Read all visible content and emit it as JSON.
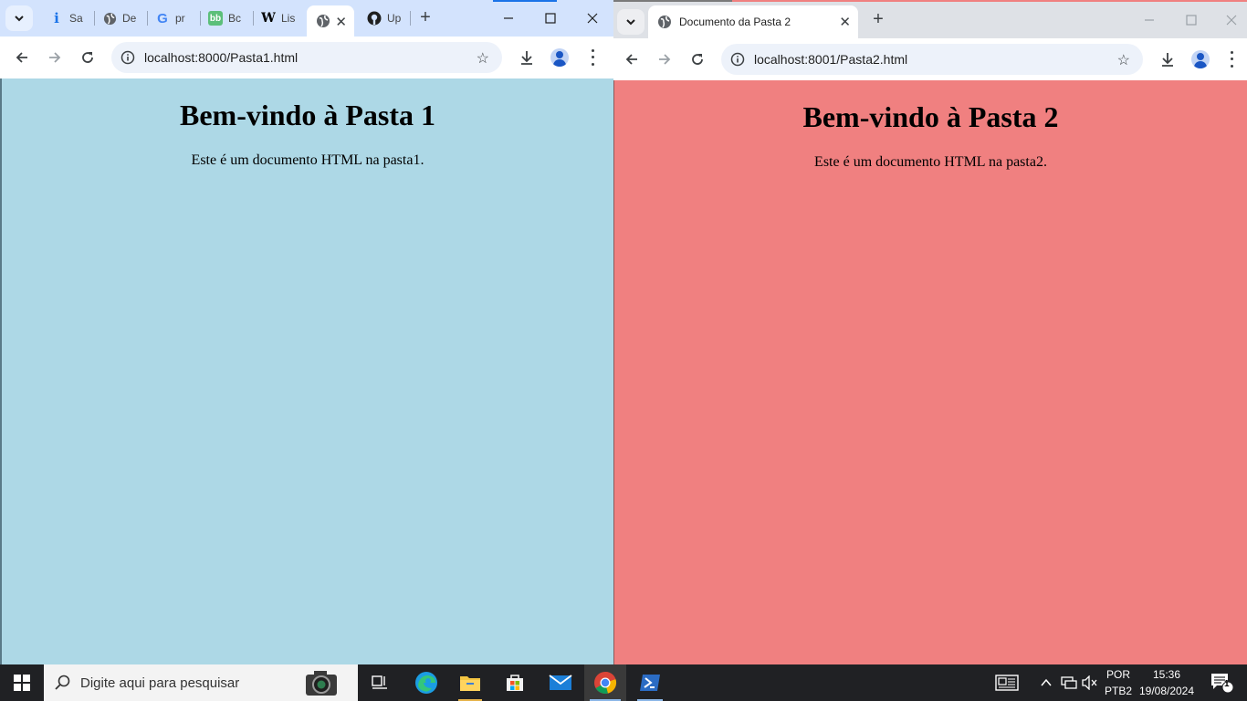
{
  "left_window": {
    "tabs": [
      {
        "label": "Sa"
      },
      {
        "label": "De"
      },
      {
        "label": "pr"
      },
      {
        "label": "Bc"
      },
      {
        "label": "Lis"
      },
      {
        "label": ""
      },
      {
        "label": "Up"
      }
    ],
    "url": "localhost:8000/Pasta1.html",
    "page": {
      "heading": "Bem-vindo à Pasta 1",
      "text": "Este é um documento HTML na pasta1."
    },
    "background": "#add8e6"
  },
  "right_window": {
    "active_tab": "Documento da Pasta 2",
    "url": "localhost:8001/Pasta2.html",
    "page": {
      "heading": "Bem-vindo à Pasta 2",
      "text": "Este é um documento HTML na pasta2."
    },
    "background": "#f08080"
  },
  "taskbar": {
    "search_placeholder": "Digite aqui para pesquisar",
    "language": "POR",
    "layout": "PTB2",
    "time": "15:36",
    "date": "19/08/2024",
    "notifications": "1",
    "apps": [
      "task-view",
      "edge",
      "file-explorer",
      "store",
      "mail",
      "chrome",
      "powershell"
    ]
  }
}
